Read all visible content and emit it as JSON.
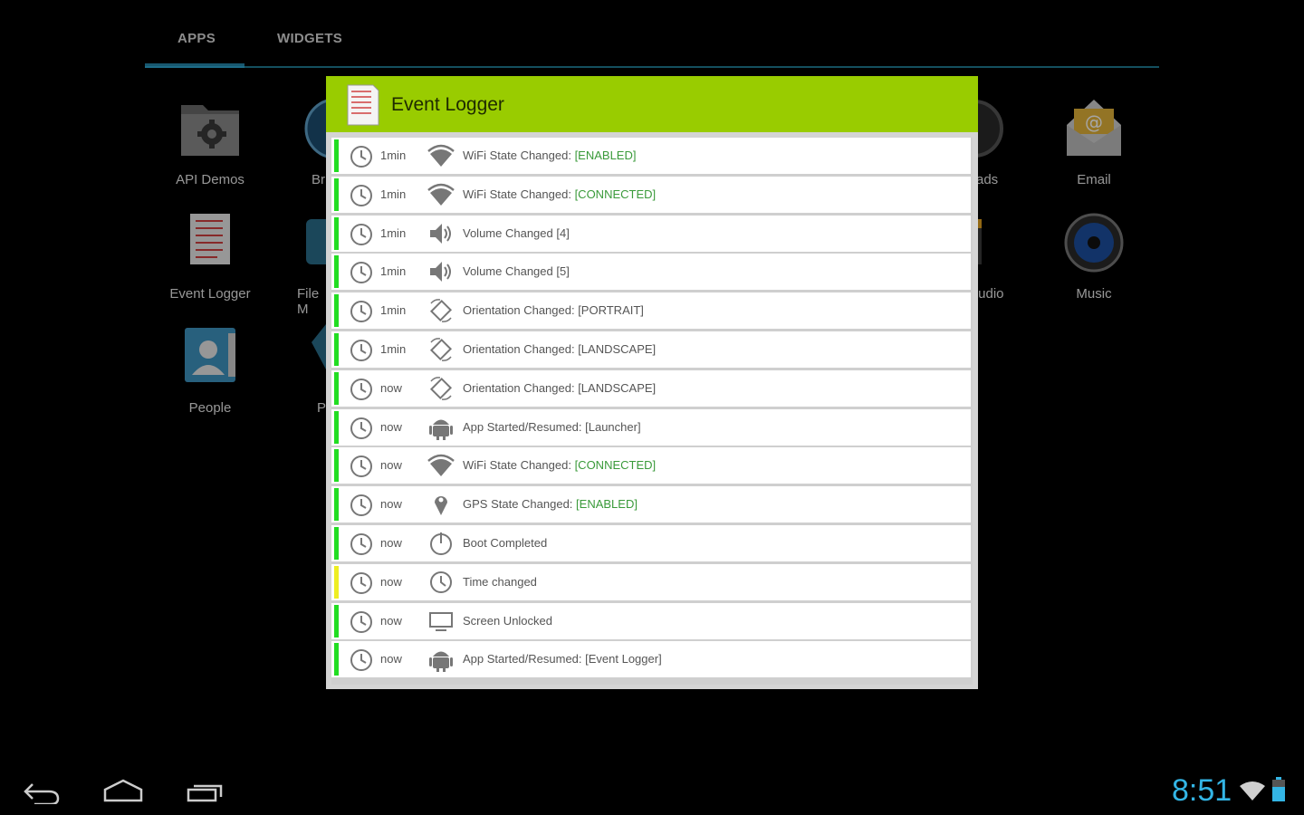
{
  "tabs": {
    "apps": "APPS",
    "widgets": "WIDGETS"
  },
  "apps": [
    {
      "label": "API Demos",
      "icon": "folder-gear-icon"
    },
    {
      "label": "Br",
      "icon": "browser-globe-icon"
    },
    {
      "label": "ads",
      "icon": "downloads-icon"
    },
    {
      "label": "Email",
      "icon": "email-icon"
    },
    {
      "label": "Event Logger",
      "icon": "event-logger-icon"
    },
    {
      "label": "File M",
      "icon": "file-manager-icon"
    },
    {
      "label": "tudio",
      "icon": "movie-studio-icon"
    },
    {
      "label": "Music",
      "icon": "music-icon"
    },
    {
      "label": "People",
      "icon": "people-icon"
    },
    {
      "label": "P",
      "icon": "app-icon"
    }
  ],
  "dialog": {
    "title": "Event Logger",
    "events": [
      {
        "time": "1min",
        "type": "wifi",
        "text": "WiFi State Changed: ",
        "highlight": "[ENABLED]",
        "color": "#22dd22"
      },
      {
        "time": "1min",
        "type": "wifi",
        "text": "WiFi State Changed: ",
        "highlight": "[CONNECTED]",
        "color": "#22dd22"
      },
      {
        "time": "1min",
        "type": "volume",
        "text": "Volume Changed [4]",
        "highlight": "",
        "color": "#22dd22"
      },
      {
        "time": "1min",
        "type": "volume",
        "text": "Volume Changed [5]",
        "highlight": "",
        "color": "#22dd22"
      },
      {
        "time": "1min",
        "type": "orientation",
        "text": "Orientation Changed: [PORTRAIT]",
        "highlight": "",
        "color": "#22dd22"
      },
      {
        "time": "1min",
        "type": "orientation",
        "text": "Orientation Changed: [LANDSCAPE]",
        "highlight": "",
        "color": "#22dd22"
      },
      {
        "time": "now",
        "type": "orientation",
        "text": "Orientation Changed: [LANDSCAPE]",
        "highlight": "",
        "color": "#22dd22"
      },
      {
        "time": "now",
        "type": "android",
        "text": "App Started/Resumed: [Launcher]",
        "highlight": "",
        "color": "#22dd22"
      },
      {
        "time": "now",
        "type": "wifi",
        "text": "WiFi State Changed: ",
        "highlight": "[CONNECTED]",
        "color": "#22dd22"
      },
      {
        "time": "now",
        "type": "gps",
        "text": "GPS State Changed: ",
        "highlight": "[ENABLED]",
        "color": "#22dd22"
      },
      {
        "time": "now",
        "type": "power",
        "text": "Boot Completed",
        "highlight": "",
        "color": "#22dd22"
      },
      {
        "time": "now",
        "type": "time",
        "text": "Time changed",
        "highlight": "",
        "color": "#eeee22"
      },
      {
        "time": "now",
        "type": "screen",
        "text": "Screen Unlocked",
        "highlight": "",
        "color": "#22dd22"
      },
      {
        "time": "now",
        "type": "android",
        "text": "App Started/Resumed: [Event Logger]",
        "highlight": "",
        "color": "#22dd22"
      }
    ]
  },
  "statusbar": {
    "time": "8:51",
    "accent": "#33b5e5"
  },
  "navbar": {
    "back": "back-icon",
    "home": "home-icon",
    "recents": "recents-icon"
  }
}
